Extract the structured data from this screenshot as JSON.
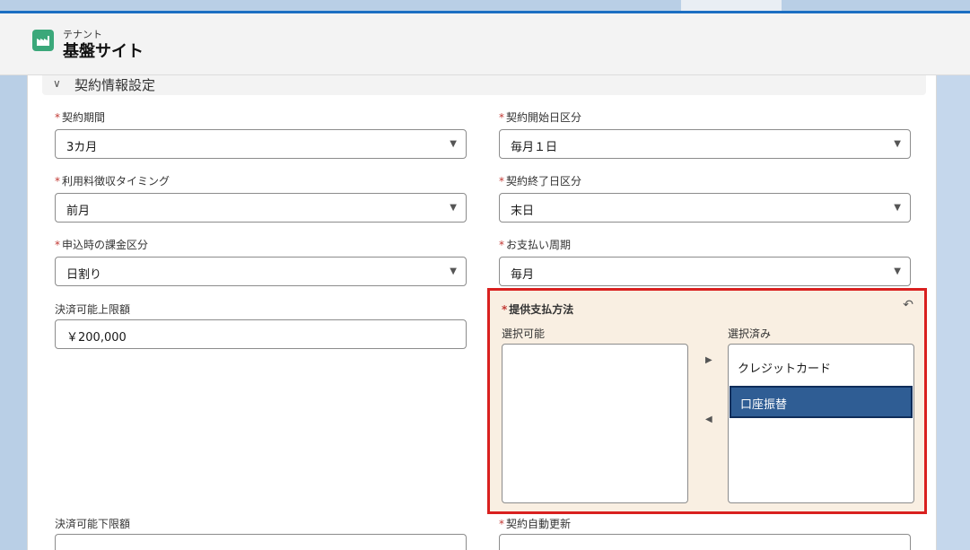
{
  "header": {
    "subtitle": "テナント",
    "title": "基盤サイト",
    "icon": "factory-icon"
  },
  "section": {
    "title": "契約情報設定",
    "chevron": "chevron-down-icon"
  },
  "fields": {
    "contract_period": {
      "label": "契約期間",
      "value": "3カ月",
      "required": true
    },
    "contract_start": {
      "label": "契約開始日区分",
      "value": "毎月１日",
      "required": true
    },
    "fee_timing": {
      "label": "利用料徴収タイミング",
      "value": "前月",
      "required": true
    },
    "contract_end": {
      "label": "契約終了日区分",
      "value": "末日",
      "required": true
    },
    "billing_on_apply": {
      "label": "申込時の課金区分",
      "value": "日割り",
      "required": true
    },
    "payment_cycle": {
      "label": "お支払い周期",
      "value": "毎月",
      "required": true
    },
    "max_amount": {
      "label": "決済可能上限額",
      "value": "￥200,000"
    },
    "min_amount": {
      "label": "決済可能下限額"
    },
    "auto_renew": {
      "label": "契約自動更新",
      "required": true
    }
  },
  "payment_methods": {
    "label": "提供支払方法",
    "available_label": "選択可能",
    "selected_label": "選択済み",
    "available": [],
    "selected": [
      "クレジットカード",
      "口座振替"
    ],
    "highlighted": "口座振替"
  },
  "glyphs": {
    "required": "*",
    "dropdown_arrow": "▼",
    "chevron": "∨",
    "undo": "↶",
    "move_right": "▶",
    "move_left": "◀"
  },
  "colors": {
    "accent_blue": "#1b6ec2",
    "required_red": "#c23934",
    "highlight_border": "#d9201f",
    "selected_option": "#2f5d94",
    "app_icon": "#3ba87a"
  }
}
